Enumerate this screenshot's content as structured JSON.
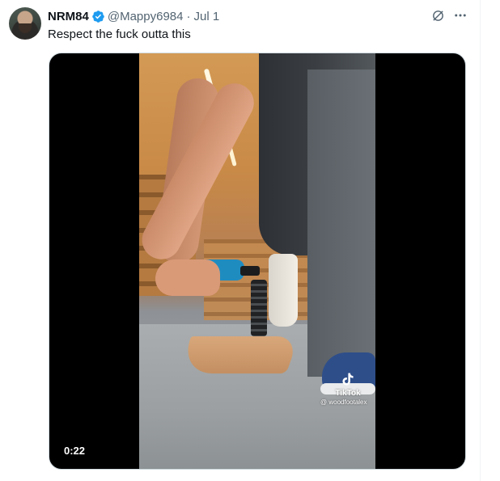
{
  "tweet": {
    "display_name": "NRM84",
    "handle": "@Mappy6984",
    "separator": "·",
    "date": "Jul 1",
    "text": "Respect the fuck outta this",
    "verified_icon": "verified-badge-icon",
    "verified_color": "#1d9bf0"
  },
  "top_actions": {
    "grok_icon": "grok-icon",
    "more_icon": "more-icon"
  },
  "media": {
    "type": "video",
    "duration": "0:22",
    "watermark": {
      "brand": "TikTok",
      "user": "@ woodfootalex"
    }
  },
  "colors": {
    "text_primary": "#0f1419",
    "text_secondary": "#536471",
    "border": "#cfd9de"
  }
}
